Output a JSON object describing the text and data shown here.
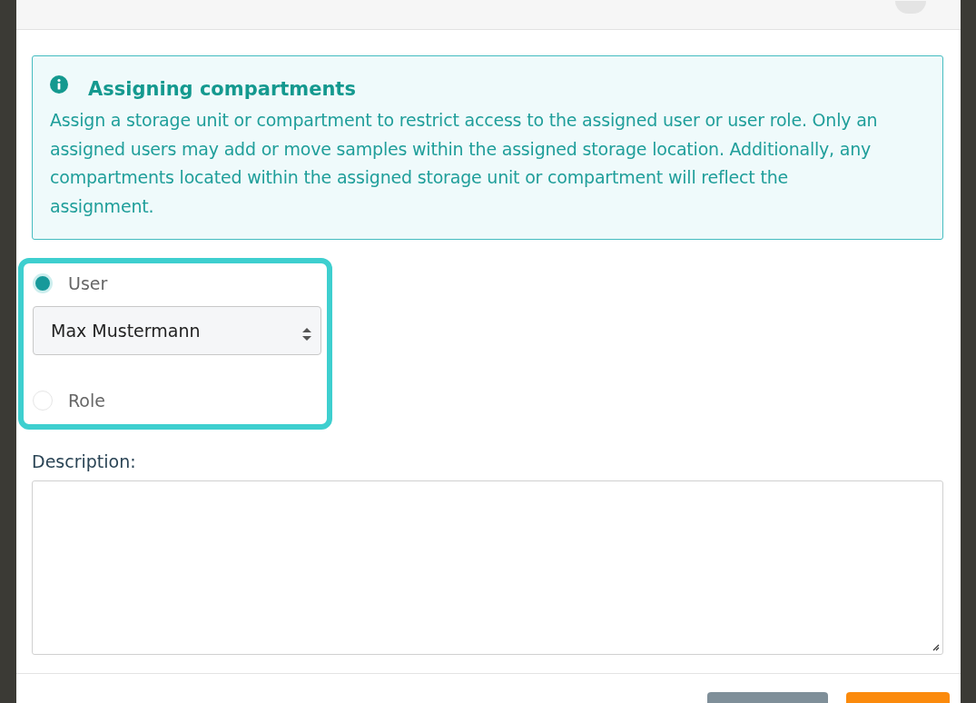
{
  "dialog": {
    "close_button": {
      "kind": "close"
    }
  },
  "alert": {
    "title": "Assigning compartments",
    "text": "Assign a storage unit or compartment to restrict access to the assigned user or user role. Only an assigned users may add or move samples within the assigned storage location. Additionally, any compartments located within the assigned storage unit or compartment will reflect the assignment."
  },
  "assignee": {
    "highlighted": true,
    "options": [
      {
        "label": "User",
        "selected": true,
        "select_value": "Max Mustermann"
      },
      {
        "label": "Role",
        "selected": false
      }
    ]
  },
  "description": {
    "label": "Description:"
  },
  "buttons": [
    {
      "kind": "secondary"
    },
    {
      "kind": "primary"
    }
  ]
}
